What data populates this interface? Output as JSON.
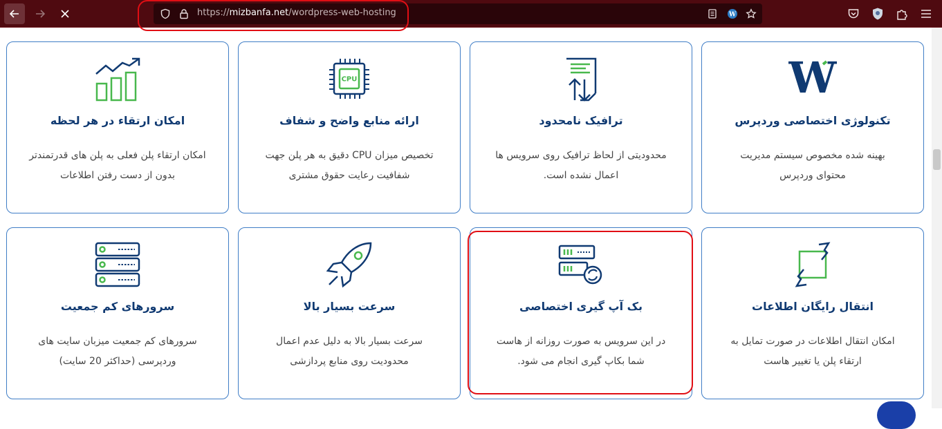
{
  "browser": {
    "url_scheme": "https://",
    "url_host": "mizbanfa.net",
    "url_path": "/wordpress-web-hosting",
    "back_icon": "arrow-left-icon",
    "forward_icon": "arrow-right-icon",
    "stop_icon": "close-icon"
  },
  "colors": {
    "accent": "#103a72",
    "green": "#48b84d",
    "border": "#3f7dc6",
    "toolbar": "#4f0a10",
    "highlight": "#e10e14"
  },
  "cards": [
    {
      "title": "تکنولوژی اختصاصی وردپرس",
      "line1": "بهینه شده مخصوص سیستم مدیریت",
      "line2": "محتوای وردپرس",
      "icon": "wordpress-icon"
    },
    {
      "title": "ترافیک نامحدود",
      "line1": "محدودیتی از لحاظ ترافیک روی سرویس ها",
      "line2": "اعمال نشده است.",
      "icon": "traffic-icon"
    },
    {
      "title": "ارائه منابع واضح و شفاف",
      "line1": "تخصیص میزان CPU دقیق به هر پلن جهت",
      "line2": "شفافیت رعایت حقوق مشتری",
      "icon": "cpu-icon",
      "cpu_label": "CPU"
    },
    {
      "title": "امکان ارتقاء در هر لحظه",
      "line1": "امکان ارتقاء پلن فعلی به پلن های قدرتمندتر",
      "line2": "بدون از دست رفتن اطلاعات",
      "icon": "growth-chart-icon"
    },
    {
      "title": "انتقال رایگان اطلاعات",
      "line1": "امکان انتقال اطلاعات در صورت تمایل به",
      "line2": "ارتقاء پلن یا تغییر هاست",
      "icon": "transfer-icon"
    },
    {
      "title": "بک آپ گیری اختصاصی",
      "line1": "در این سرویس به صورت روزانه از هاست",
      "line2": "شما بکاپ گیری انجام می شود.",
      "icon": "backup-server-icon"
    },
    {
      "title": "سرعت بسیار بالا",
      "line1": "سرعت بسیار بالا به دلیل عدم اعمال",
      "line2": "محدودیت روی منابع پردازشی",
      "icon": "rocket-icon"
    },
    {
      "title": "سرورهای کم جمعیت",
      "line1": "سرورهای کم جمعیت میزبان سایت های",
      "line2": "وردپرسی (حداکثر 20 سایت)",
      "icon": "server-stack-icon"
    }
  ]
}
